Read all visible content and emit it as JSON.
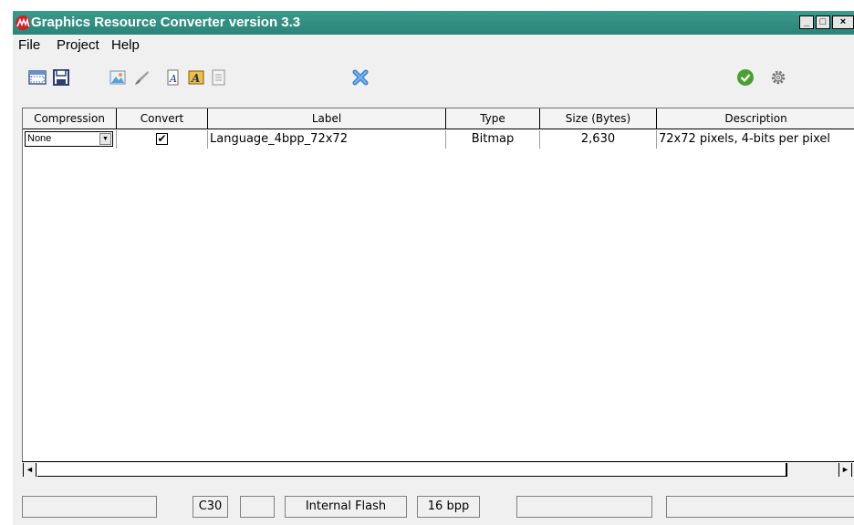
{
  "window": {
    "title": "Graphics Resource Converter version 3.3",
    "logo": "microchip-logo-icon",
    "accent": "#2e8a7d"
  },
  "window_controls": {
    "minimize": "_",
    "maximize": "□",
    "close": "×"
  },
  "menu": {
    "items": [
      "File",
      "Project",
      "Help"
    ]
  },
  "toolbar": {
    "icons": [
      "open-folder-icon",
      "save-icon",
      "add-image-icon",
      "brush-icon",
      "add-font-icon",
      "add-font-highlighted-icon",
      "document-icon",
      "delete-icon",
      "convert-check-icon",
      "settings-gear-icon"
    ]
  },
  "table": {
    "columns": [
      "Compression",
      "Convert",
      "Label",
      "Type",
      "Size (Bytes)",
      "Description"
    ],
    "rows": [
      {
        "compression": "None",
        "convert_checked": true,
        "label": "Language_4bpp_72x72",
        "type": "Bitmap",
        "size": "2,630",
        "description": "72x72 pixels, 4-bits per pixel"
      }
    ]
  },
  "scrollbar": {
    "left_arrow": "◄",
    "right_arrow": "►"
  },
  "status": {
    "field1": "",
    "compiler": "C30",
    "field3": "",
    "memory": "Internal Flash",
    "color_depth": "16 bpp",
    "field6": "",
    "field7": ""
  },
  "checkmark": "✔",
  "combo_arrow": "▼"
}
